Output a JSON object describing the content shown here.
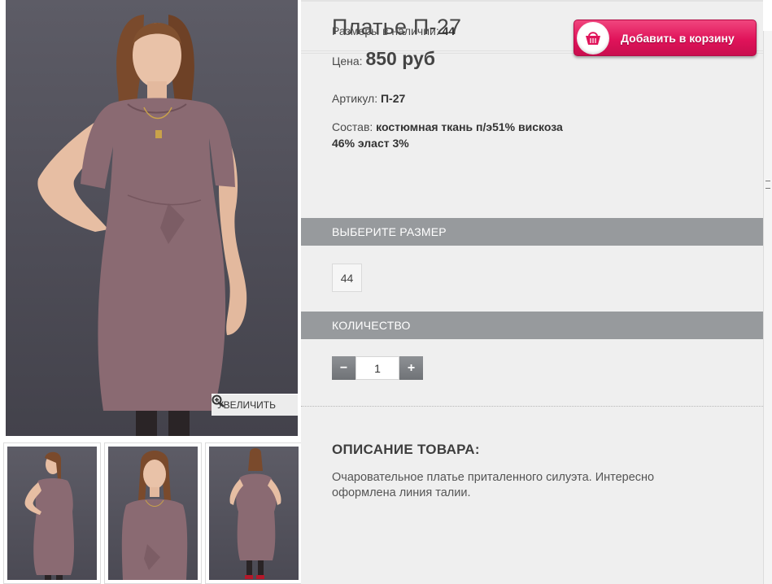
{
  "product": {
    "title": "Платье П-27",
    "sizes_label": "Размеры в наличии:",
    "sizes_value": "44",
    "price_label": "Цена:",
    "price_value": "850 руб",
    "sku_label": "Артикул:",
    "sku_value": "П-27",
    "composition_label": "Состав:",
    "composition_value": "костюмная ткань п/э51% вискоза 46% эласт 3%"
  },
  "cart": {
    "label": "Добавить в корзину",
    "icon": "basket-icon"
  },
  "gallery": {
    "zoom_label": "УВЕЛИЧИТЬ",
    "zoom_icon": "magnifier-plus-icon",
    "thumbnails": 3
  },
  "size_select": {
    "heading": "ВЫБЕРИТЕ РАЗМЕР",
    "options": [
      "44"
    ]
  },
  "quantity": {
    "heading": "КОЛИЧЕСТВО",
    "minus": "−",
    "plus": "+",
    "value": "1"
  },
  "description": {
    "heading": "ОПИСАНИЕ ТОВАРА:",
    "text": "Очаровательное платье приталенного силуэта. Интересно оформлена линия талии."
  },
  "colors": {
    "accent": "#e0135a",
    "section_bar": "#979a9d",
    "panel_bg": "#efefef",
    "dress": "#8a6a72"
  }
}
